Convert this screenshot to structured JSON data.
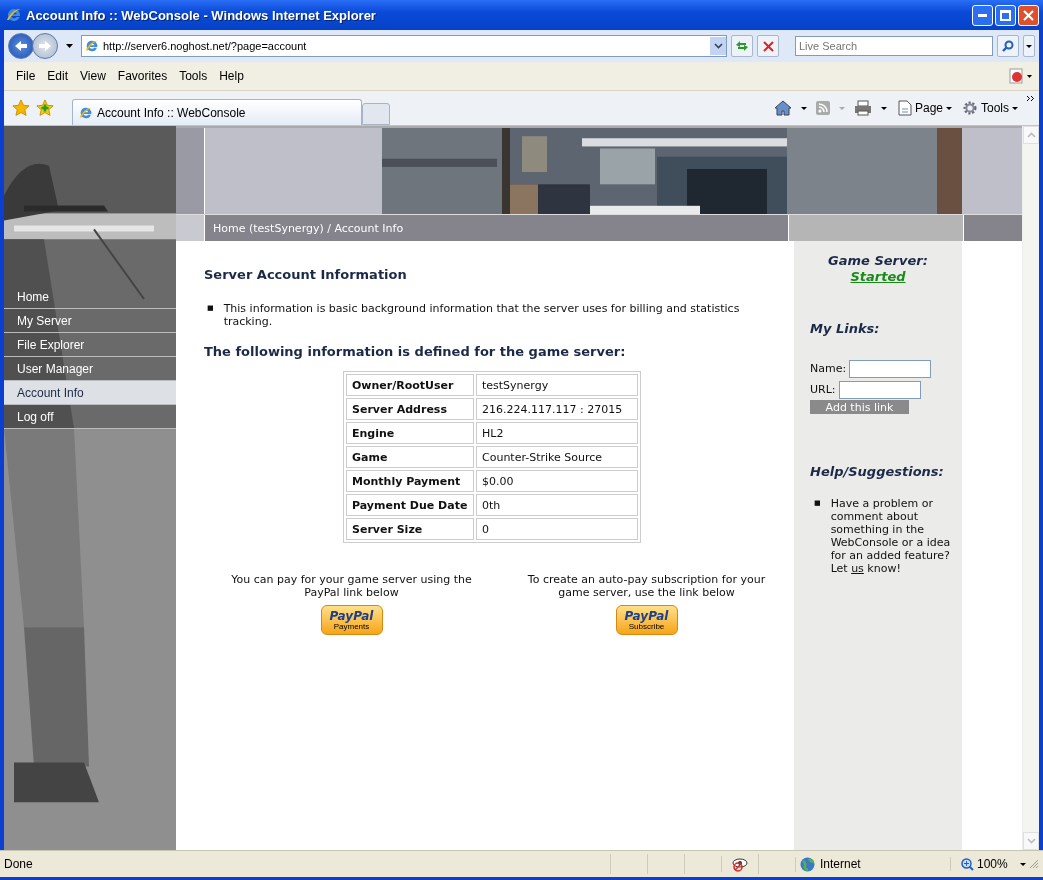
{
  "window": {
    "title": "Account Info :: WebConsole - Windows Internet Explorer"
  },
  "address_bar": {
    "url": "http://server6.noghost.net/?page=account"
  },
  "search": {
    "placeholder": "Live Search"
  },
  "menu": [
    "File",
    "Edit",
    "View",
    "Favorites",
    "Tools",
    "Help"
  ],
  "tabs": [
    {
      "label": "Account Info :: WebConsole",
      "selected": true
    }
  ],
  "command_bar": [
    "Page",
    "Tools"
  ],
  "page": {
    "breadcrumb": "Home (testSynergy) / Account Info",
    "nav": [
      {
        "label": "Home",
        "selected": false
      },
      {
        "label": "My Server",
        "selected": false
      },
      {
        "label": "File Explorer",
        "selected": false
      },
      {
        "label": "User Manager",
        "selected": false
      },
      {
        "label": "Account Info",
        "selected": true
      },
      {
        "label": "Log off",
        "selected": false
      }
    ],
    "heading": "Server Account Information",
    "bullet": "■",
    "intro": "This information is basic background information that the server uses for billing and statistics tracking.",
    "subheading": "The following information is defined for the game server:",
    "details": [
      {
        "label": "Owner/RootUser",
        "value": "testSynergy"
      },
      {
        "label": "Server Address",
        "value": "216.224.117.117 : 27015"
      },
      {
        "label": "Engine",
        "value": "HL2"
      },
      {
        "label": "Game",
        "value": "Counter-Strike Source"
      },
      {
        "label": "Monthly Payment",
        "value": "$0.00"
      },
      {
        "label": "Payment Due Date",
        "value": "0th"
      },
      {
        "label": "Server Size",
        "value": "0"
      }
    ],
    "payments": [
      {
        "text": "You can pay for your game server using the PayPal link below",
        "brand": "PayPal",
        "caption": "Payments"
      },
      {
        "text": "To create an auto-pay subscription for your game server, use the link below",
        "brand": "PayPal",
        "caption": "Subscribe"
      }
    ],
    "sidebar": {
      "status_label": "Game Server:",
      "status": "Started",
      "links_title": "My Links:",
      "name_label": "Name:",
      "url_label": "URL:",
      "add_button": "Add this link",
      "help_title": "Help/Suggestions:",
      "help_text": "Have a problem or comment about something in the WebConsole or a idea for an added feature? Let",
      "help_link": "us",
      "help_end": "know!"
    }
  },
  "status_bar": {
    "text": "Done",
    "zone": "Internet",
    "zoom": "100%"
  }
}
